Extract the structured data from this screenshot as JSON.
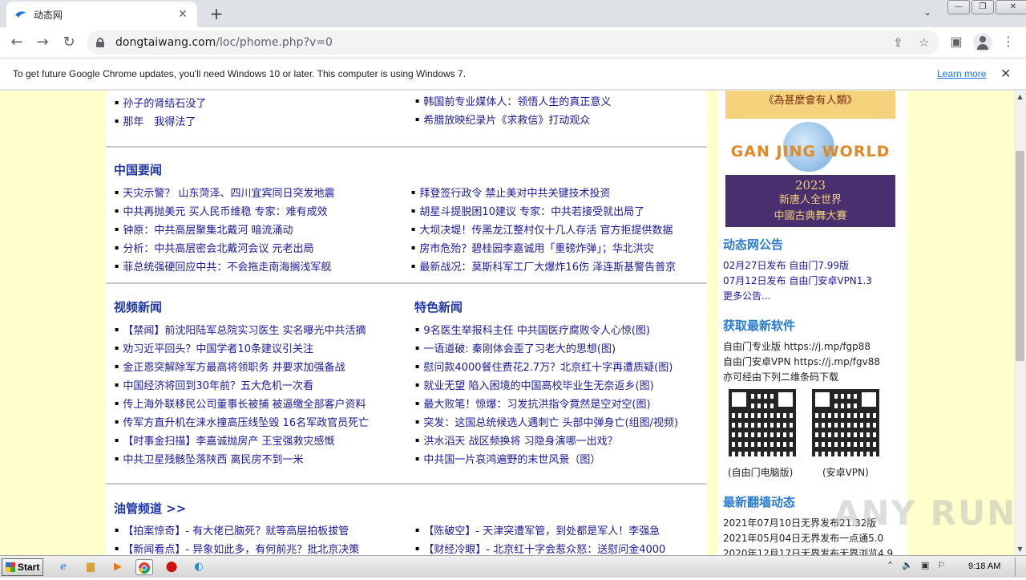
{
  "browser": {
    "tab_title": "动态网",
    "url_host": "dongtaiwang.com",
    "url_path": "/loc/phome.php?v=0",
    "new_tab_label": "+",
    "tab_close_label": "✕",
    "win_min": "—",
    "win_max": "❐",
    "win_close": "✕"
  },
  "infobar": {
    "text": "To get future Google Chrome updates, you'll need Windows 10 or later. This computer is using Windows 7.",
    "link": "Learn more",
    "close": "✕"
  },
  "top_links": {
    "left": [
      "孙子的肾结石没了",
      "那年　我得法了"
    ],
    "right": [
      "韩国前专业媒体人：领悟人生的真正意义",
      "希腊放映纪录片《求救信》打动观众"
    ]
  },
  "china_news": {
    "title": "中国要闻",
    "left": [
      "天灾示警？ 山东菏泽、四川宜宾同日突发地震",
      "中共再抛美元 买人民币维稳 专家：难有成效",
      "钟原：中共高层聚集北戴河 暗流涌动",
      "分析：中共高层密会北戴河会议 元老出局",
      "菲总统强硬回应中共：不会拖走南海搁浅军舰"
    ],
    "right": [
      "拜登签行政令 禁止美对中共关键技术投资",
      "胡星斗提脱困10建议 专家：中共若接受就出局了",
      "大坝决堤！传黑龙江整村仅十几人存活 官方拒提供数据",
      "房市危殆？碧桂园李嘉诚用「重磅炸弹」；华北洪灾",
      "最新战况：莫斯科军工厂大爆炸16伤 泽连斯基警告普京"
    ]
  },
  "video_news": {
    "title": "视频新闻",
    "items": [
      "【禁闻】前沈阳陆军总院实习医生 实名曝光中共活摘",
      "劝习近平回头？中国学者10条建议引关注",
      "金正恩突解除军方最高将领职务 并要求加强备战",
      "中国经济将回到30年前？五大危机一次看",
      "传上海外联移民公司董事长被捕 被逼缴全部客户资料",
      "传军方直升机在涞水撞高压线坠毁 16名军政官员死亡",
      "【时事金扫描】李嘉诚抛房产 王宝强救灾感慨",
      "中共卫星残骸坠落陕西 离民房不到一米"
    ]
  },
  "featured_news": {
    "title": "特色新闻",
    "items": [
      "9名医生举报科主任 中共国医疗腐败令人心惊(图)",
      "一语道破: 秦刚体会歪了习老大的思想(图)",
      "慰问款4000餐住费花2.7万？北京红十字再遭质疑(图)",
      "就业无望 陷入困境的中国高校毕业生无奈返乡(图)",
      "最大败笔！惊爆：习发抗洪指令竟然是空对空(图)",
      "突发：这国总统候选人遇刺亡 头部中弹身亡(组图/视频)",
      "洪水滔天 战区频换将 习隐身演哪一出戏？",
      "中共国一片哀鸿遍野的末世风景（图）"
    ]
  },
  "youtube_channel": {
    "title": "油管频道 >>",
    "left": [
      "【拍案惊奇】- 有大佬已脑死？就等高层拍板拔管",
      "【新闻看点】- 异象如此多，有何前兆？批北京决策"
    ],
    "right": [
      "【陈破空】- 天津突遭军管，到处都是军人！李强急",
      "【财经冷眼】- 北京红十字会惹众怒：送慰问金4000"
    ]
  },
  "sidebar": {
    "banner_top": "《為甚麼會有人類》",
    "banner_brand": "GAN JING WORLD",
    "banner_year": "2023",
    "banner_line1": "新唐人全世界",
    "banner_line2": "中國古典舞大賽",
    "announce_title": "动态网公告",
    "announce": [
      "02月27日发布 自由门7.99版",
      "07月12日发布 自由门安卓VPN1.3",
      "更多公告..."
    ],
    "software_title": "获取最新软件",
    "software": [
      "自由门专业版 https://j.mp/fgp88",
      "自由门安卓VPN https://j.mp/fgv88",
      "亦可经由下列二维条码下载"
    ],
    "qr_left_caption": "(自由门电脑版)",
    "qr_right_caption": "(安卓VPN)",
    "firewall_title": "最新翻墙动态",
    "firewall": [
      "2021年07月10日无界发布21.32版",
      "2021年05月04日无界发布一点通5.0",
      "2020年12月17日无界发布无界浏览4.9"
    ]
  },
  "watermark": "ANY RUN",
  "taskbar": {
    "start": "Start",
    "clock": "9:18 AM"
  }
}
